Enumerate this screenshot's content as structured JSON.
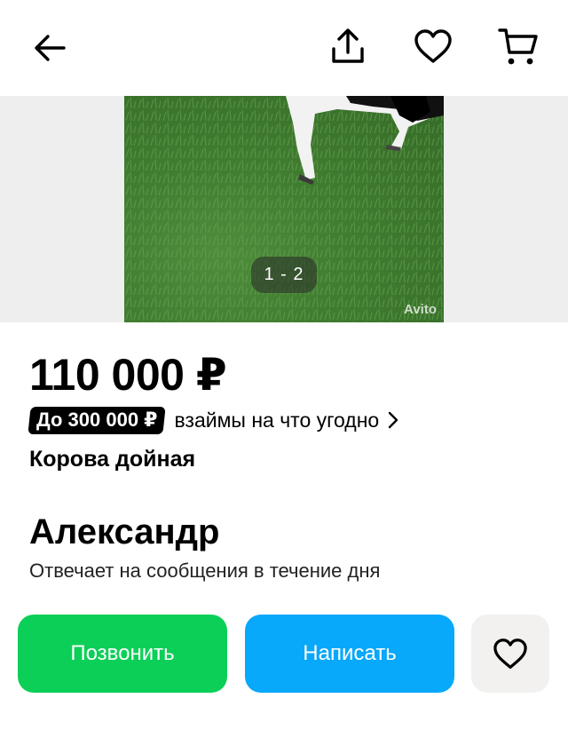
{
  "header": {
    "back_icon": "arrow-left-icon",
    "share_icon": "share-icon",
    "favorite_icon": "heart-icon",
    "cart_icon": "cart-icon"
  },
  "gallery": {
    "counter": "1 - 2",
    "watermark": "Avito"
  },
  "listing": {
    "price": "110 000 ₽",
    "loan_badge": "До 300 000 ₽",
    "loan_text": "взаймы на что угодно",
    "title": "Корова дойная"
  },
  "seller": {
    "name": "Александр",
    "response": "Отвечает на сообщения в течение дня"
  },
  "actions": {
    "call_label": "Позвонить",
    "write_label": "Написать",
    "call_color": "#0ccf57",
    "write_color": "#08a8fa"
  }
}
